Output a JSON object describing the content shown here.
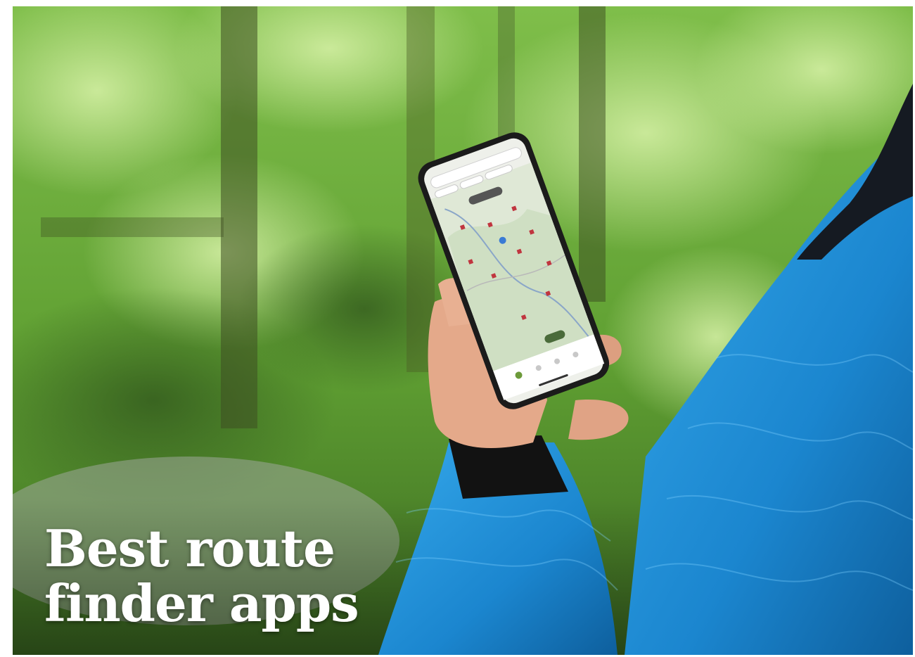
{
  "headline": {
    "line1": "Best route",
    "line2": "finder apps",
    "color": "#ffffff"
  },
  "colors": {
    "forest_light": "#8fd05a",
    "forest_mid": "#4f8f2a",
    "forest_dark": "#23401a",
    "jacket_blue": "#1e8fd6",
    "jacket_dark": "#0d5d98",
    "phone_frame": "#1b1b1b",
    "map_bg": "#dfe8d6",
    "map_marker": "#c0353f",
    "skin": "#e4a98a"
  }
}
